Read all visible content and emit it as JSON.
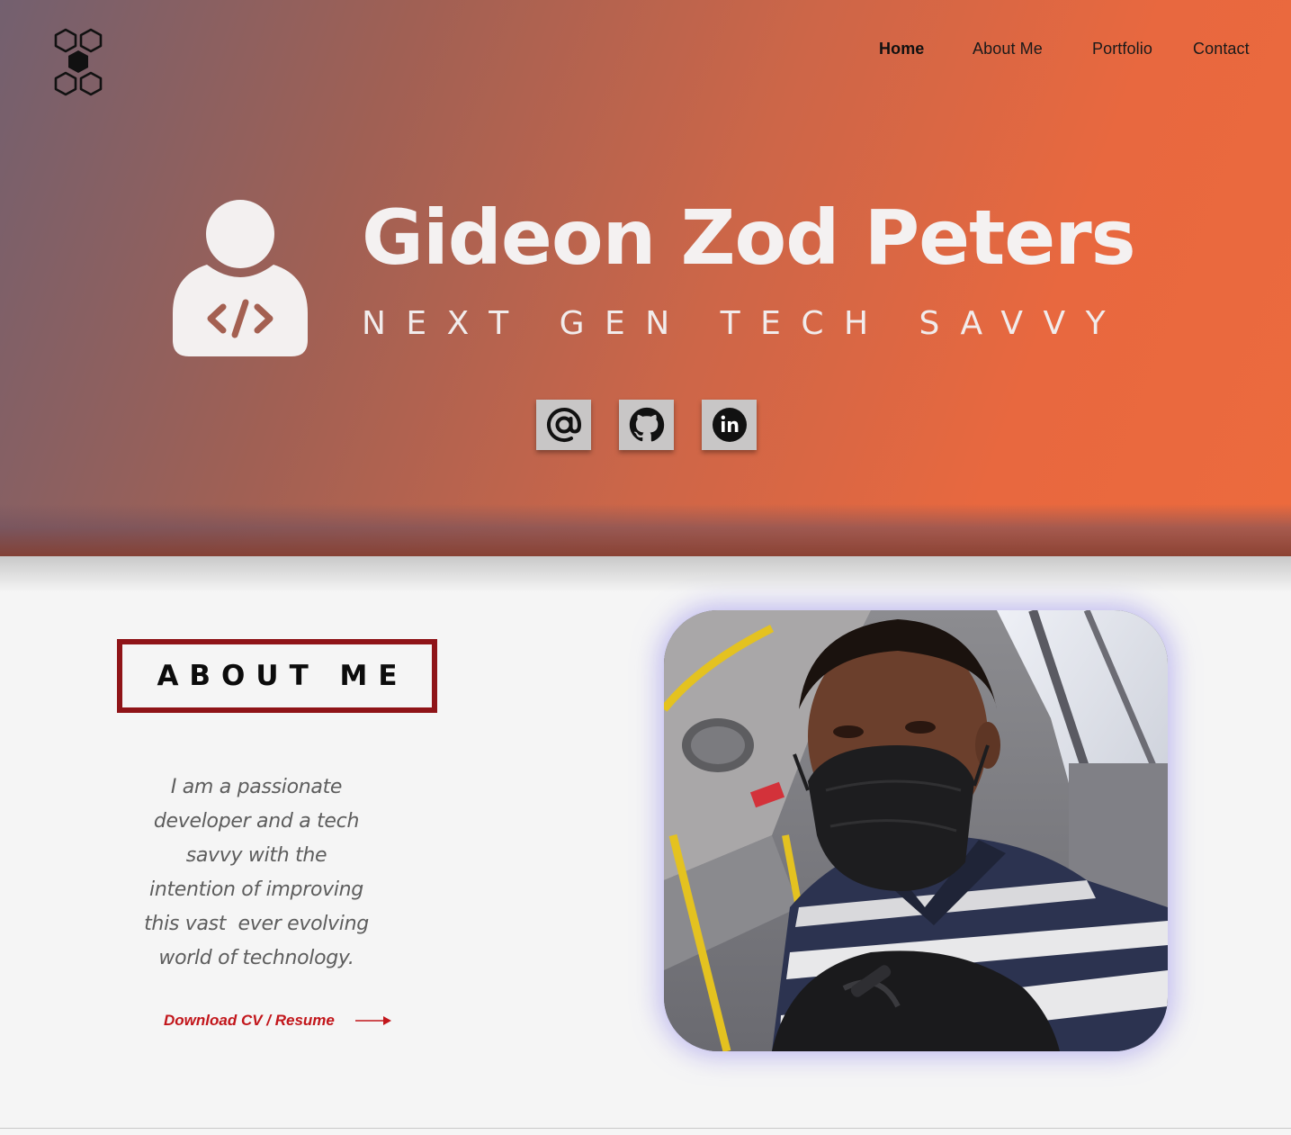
{
  "nav": {
    "items": [
      {
        "label": "Home",
        "active": true
      },
      {
        "label": "About Me",
        "active": false
      },
      {
        "label": "Portfolio",
        "active": false
      },
      {
        "label": "Contact",
        "active": false
      }
    ]
  },
  "hero": {
    "name": "Gideon Zod Peters",
    "tagline": "NEXT GEN TECH SAVVY",
    "avatar_icon": "developer-avatar-icon",
    "social": [
      {
        "name": "email",
        "icon": "at-sign-icon"
      },
      {
        "name": "github",
        "icon": "github-icon"
      },
      {
        "name": "linkedin",
        "icon": "linkedin-icon"
      }
    ]
  },
  "about": {
    "title": "ABOUT ME",
    "lines": [
      "I am a passionate",
      "developer and a tech",
      "savvy with the",
      "intention of improving",
      "this vast  ever evolving",
      "world of technology."
    ],
    "cv_label": "Download CV / Resume"
  },
  "colors": {
    "accent_red": "#c2161b",
    "frame_red": "#8f1418",
    "hero_start": "#73606f",
    "hero_end": "#ec6a3d",
    "photo_glow": "#968ceb"
  }
}
